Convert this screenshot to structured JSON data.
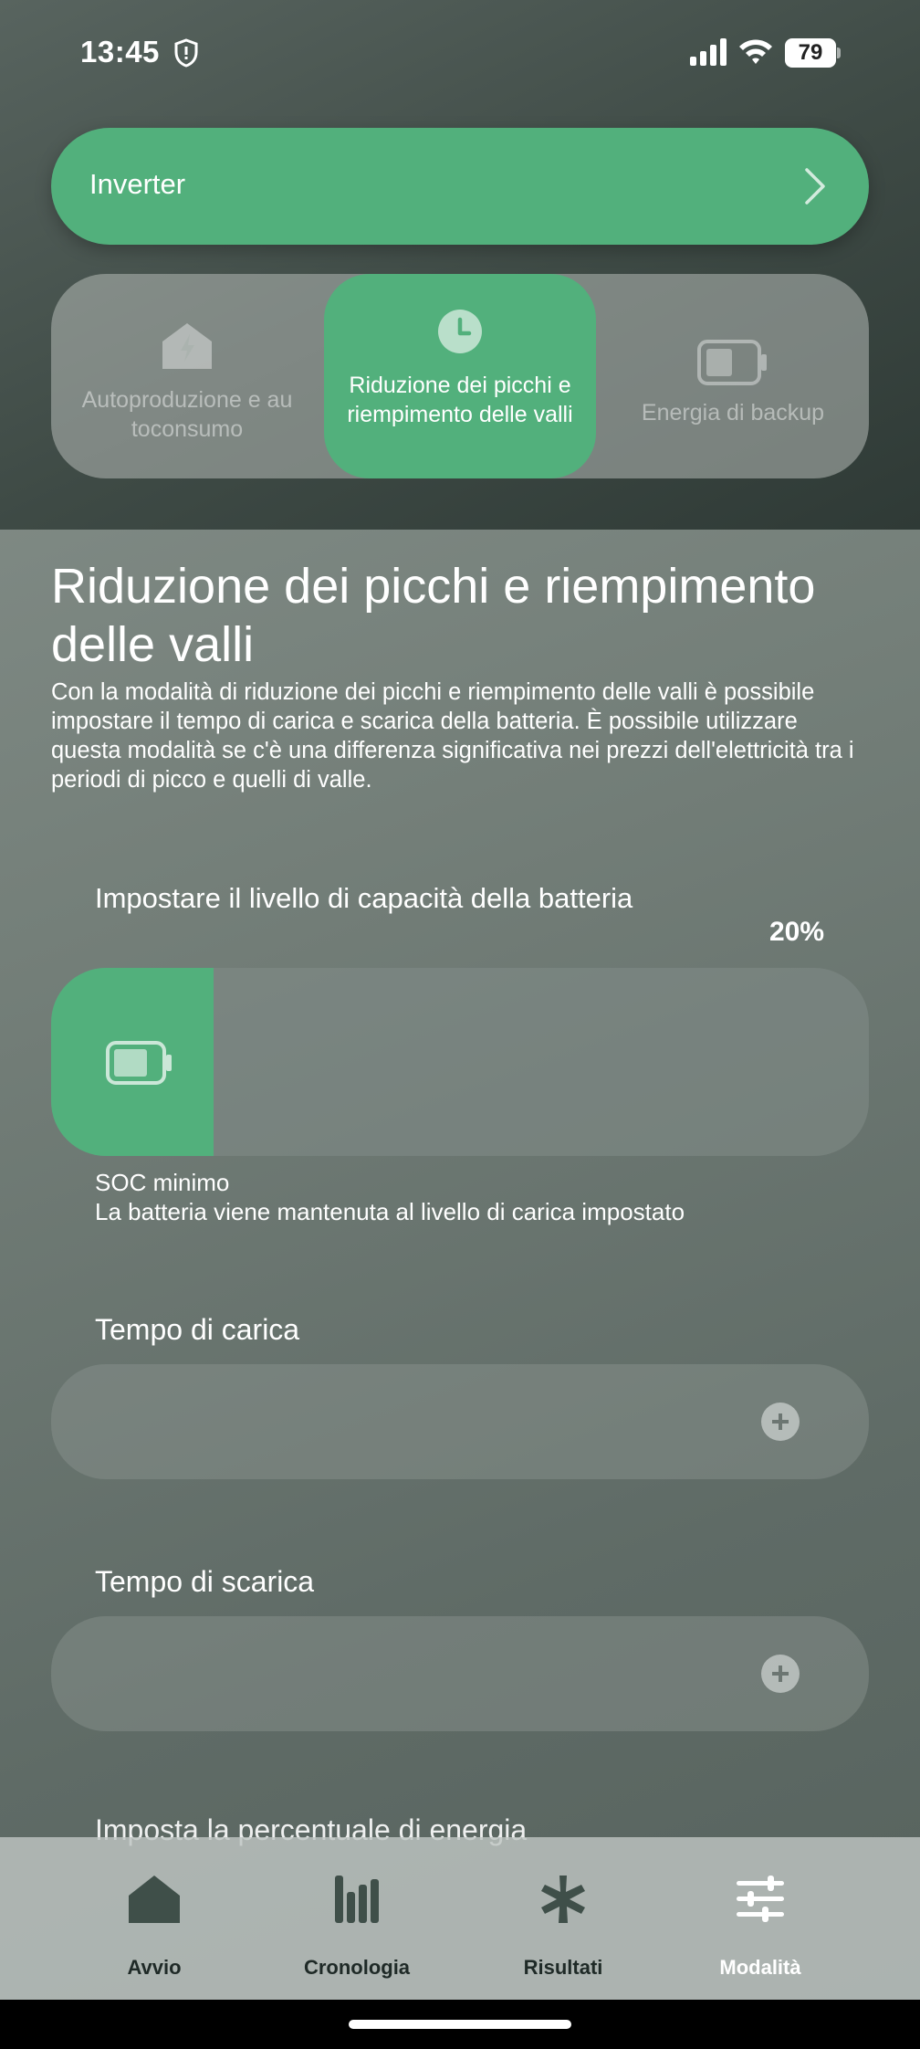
{
  "status_bar": {
    "time": "13:45",
    "battery_level": "79"
  },
  "inverter": {
    "label": "Inverter"
  },
  "modes": [
    {
      "label": "Autoproduzione e au toconsumo",
      "icon": "lightning-house-icon",
      "active": false
    },
    {
      "label": "Riduzione dei picchi e riempimento delle valli",
      "icon": "clock-icon",
      "active": true
    },
    {
      "label": "Energia di backup",
      "icon": "battery-icon",
      "active": false
    }
  ],
  "content": {
    "title": "Riduzione dei picchi e riempimento delle valli",
    "description": "Con la modalità di riduzione dei picchi e riempimento delle valli è possibile impostare il tempo di carica e scarica della batteria. È possibile utilizzare questa modalità se c'è una differenza significativa nei prezzi dell'elettricità tra i periodi di picco e quelli di valle."
  },
  "capacity": {
    "label": "Impostare il livello di capacità della batteria",
    "value_text": "20%",
    "value": 0.2,
    "soc_title": "SOC minimo",
    "soc_desc": "La batteria viene mantenuta al livello di carica impostato"
  },
  "charge_time": {
    "label": "Tempo di carica"
  },
  "discharge_time": {
    "label": "Tempo di scarica"
  },
  "energy_percentage": {
    "label": "Imposta la percentuale di energia"
  },
  "bottom_nav": [
    {
      "label": "Avvio",
      "icon": "home-icon",
      "active": false
    },
    {
      "label": "Cronologia",
      "icon": "bar-chart-icon",
      "active": false
    },
    {
      "label": "Risultati",
      "icon": "star-icon",
      "active": false
    },
    {
      "label": "Modalità",
      "icon": "sliders-icon",
      "active": true
    }
  ],
  "colors": {
    "accent": "#52b07c",
    "nav_text": "#1f2a27"
  }
}
